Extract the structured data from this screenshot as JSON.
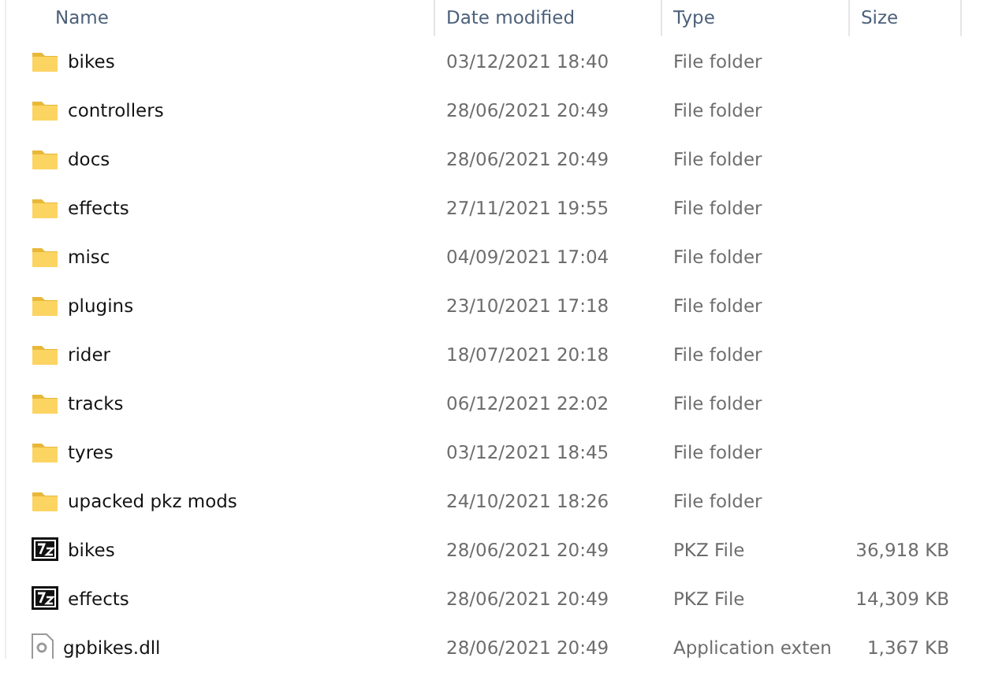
{
  "columns": [
    "Name",
    "Date modified",
    "Type",
    "Size"
  ],
  "rows": [
    {
      "kind": "folder",
      "name": "bikes",
      "date": "03/12/2021 18:40",
      "type": "File folder"
    },
    {
      "kind": "folder",
      "name": "controllers",
      "date": "28/06/2021 20:49",
      "type": "File folder"
    },
    {
      "kind": "folder",
      "name": "docs",
      "date": "28/06/2021 20:49",
      "type": "File folder"
    },
    {
      "kind": "folder",
      "name": "effects",
      "date": "27/11/2021 19:55",
      "type": "File folder"
    },
    {
      "kind": "folder",
      "name": "misc",
      "date": "04/09/2021 17:04",
      "type": "File folder"
    },
    {
      "kind": "folder",
      "name": "plugins",
      "date": "23/10/2021 17:18",
      "type": "File folder"
    },
    {
      "kind": "folder",
      "name": "rider",
      "date": "18/07/2021 20:18",
      "type": "File folder"
    },
    {
      "kind": "folder",
      "name": "tracks",
      "date": "06/12/2021 22:02",
      "type": "File folder"
    },
    {
      "kind": "folder",
      "name": "tyres",
      "date": "03/12/2021 18:45",
      "type": "File folder"
    },
    {
      "kind": "folder",
      "name": "upacked pkz mods",
      "date": "24/10/2021 18:26",
      "type": "File folder"
    },
    {
      "kind": "archive",
      "name": "bikes",
      "date": "28/06/2021 20:49",
      "type": "PKZ File",
      "size": "36,918 KB"
    },
    {
      "kind": "archive",
      "name": "effects",
      "date": "28/06/2021 20:49",
      "type": "PKZ File",
      "size": "14,309 KB"
    },
    {
      "kind": "file",
      "name": "gpbikes.dll",
      "date": "28/06/2021 20:49",
      "type": "Application exten",
      "size": "1,367 KB"
    }
  ]
}
